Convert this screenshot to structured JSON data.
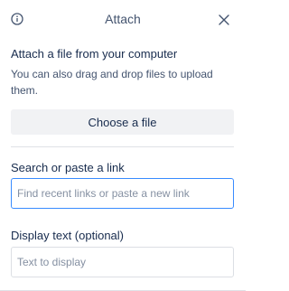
{
  "header": {
    "title": "Attach",
    "info_icon": "info-icon",
    "close_icon": "close-icon"
  },
  "upload": {
    "heading": "Attach a file from your computer",
    "helper": "You can also drag and drop files to upload them.",
    "button_label": "Choose a file"
  },
  "link": {
    "label": "Search or paste a link",
    "placeholder": "Find recent links or paste a new link",
    "value": ""
  },
  "display_text": {
    "label": "Display text (optional)",
    "placeholder": "Text to display",
    "value": ""
  },
  "colors": {
    "accent": "#388bff",
    "button_bg": "#f1f2f4",
    "text": "#172b4d",
    "subtle_text": "#44546f"
  }
}
